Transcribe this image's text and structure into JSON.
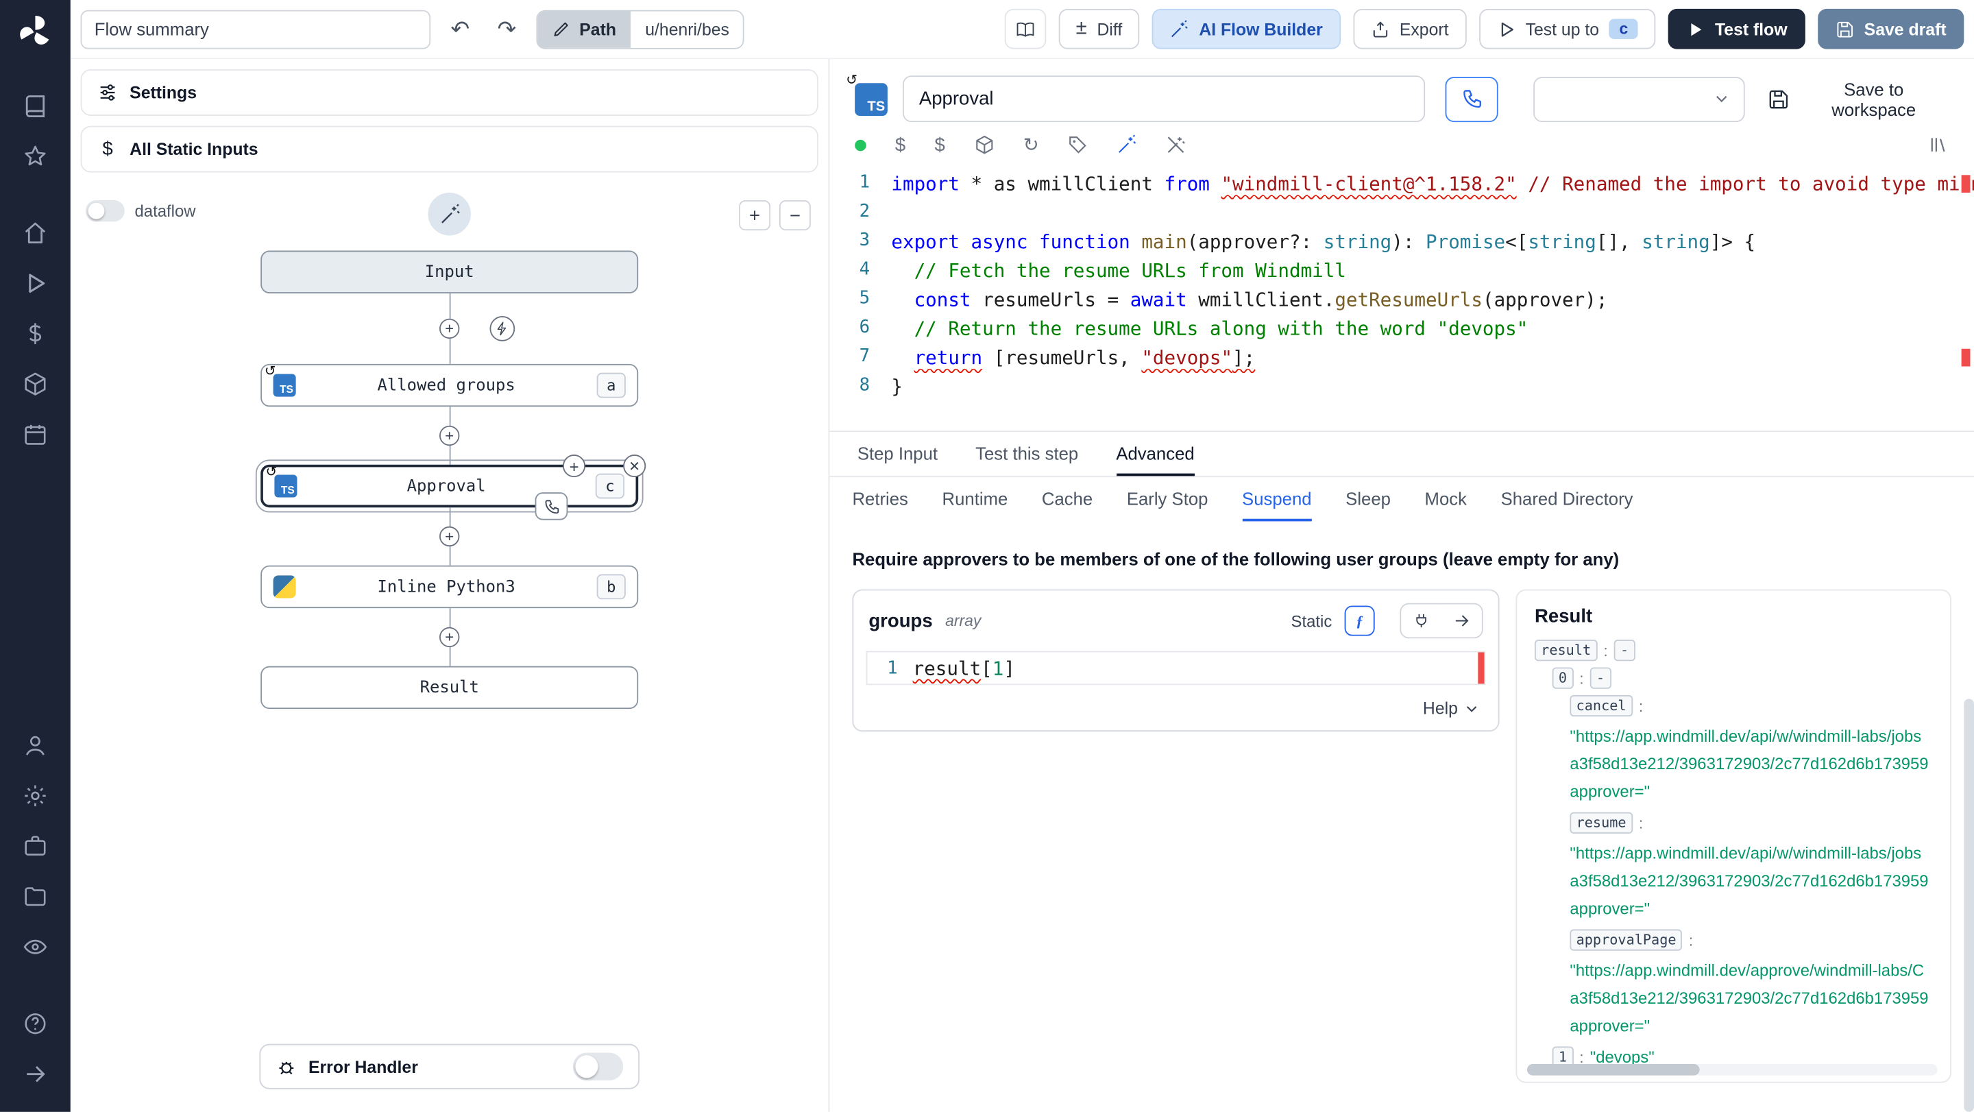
{
  "icons": {
    "undo": "↶",
    "redo": "↷",
    "diff": "±",
    "refresh": "↻",
    "loop": "↺",
    "plus": "+",
    "minus": "−",
    "close": "✕",
    "ts": "TS",
    "dollar": "$",
    "fx": "ƒ"
  },
  "topbar": {
    "flow_summary_value": "Flow summary",
    "path_label": "Path",
    "path_value": "u/henri/bes",
    "diff_label": "Diff",
    "ai_flow_builder_label": "AI Flow Builder",
    "export_label": "Export",
    "test_up_to_label": "Test up to",
    "test_up_to_badge": "c",
    "test_flow_label": "Test flow",
    "save_draft_label": "Save draft"
  },
  "flow_panel": {
    "settings_label": "Settings",
    "static_inputs_label": "All Static Inputs",
    "dataflow_label": "dataflow",
    "nodes": {
      "input_label": "Input",
      "allowed_groups_label": "Allowed groups",
      "allowed_groups_badge": "a",
      "approval_label": "Approval",
      "approval_badge": "c",
      "python_label": "Inline Python3",
      "python_badge": "b",
      "result_label": "Result"
    },
    "error_handler_label": "Error Handler"
  },
  "step": {
    "name_value": "Approval",
    "save_to_workspace_label": "Save to workspace",
    "tabs": [
      "Step Input",
      "Test this step",
      "Advanced"
    ],
    "active_tab": "Advanced",
    "subtabs": [
      "Retries",
      "Runtime",
      "Cache",
      "Early Stop",
      "Suspend",
      "Sleep",
      "Mock",
      "Shared Directory"
    ],
    "active_subtab": "Suspend",
    "code_lines": [
      {
        "n": "1",
        "segs": [
          {
            "c": "kw",
            "t": "import"
          },
          {
            "c": "pln",
            "t": " * as wmillClient "
          },
          {
            "c": "kw",
            "t": "from"
          },
          {
            "c": "pln",
            "t": " "
          },
          {
            "c": "str err",
            "t": "\"windmill-client@^1.158.2\""
          },
          {
            "c": "strc",
            "t": " // Renamed the import to avoid type mismatch"
          }
        ]
      },
      {
        "n": "2",
        "segs": []
      },
      {
        "n": "3",
        "segs": [
          {
            "c": "kw",
            "t": "export"
          },
          {
            "c": "pln",
            "t": " "
          },
          {
            "c": "kw",
            "t": "async"
          },
          {
            "c": "pln",
            "t": " "
          },
          {
            "c": "kw",
            "t": "function"
          },
          {
            "c": "pln",
            "t": " "
          },
          {
            "c": "fn",
            "t": "main"
          },
          {
            "c": "pln",
            "t": "(approver?: "
          },
          {
            "c": "typ",
            "t": "string"
          },
          {
            "c": "pln",
            "t": "): "
          },
          {
            "c": "typ",
            "t": "Promise"
          },
          {
            "c": "pln",
            "t": "<["
          },
          {
            "c": "typ",
            "t": "string"
          },
          {
            "c": "pln",
            "t": "[], "
          },
          {
            "c": "typ",
            "t": "string"
          },
          {
            "c": "pln",
            "t": "]> {"
          }
        ]
      },
      {
        "n": "4",
        "segs": [
          {
            "c": "com",
            "t": "  // Fetch the resume URLs from Windmill"
          }
        ]
      },
      {
        "n": "5",
        "segs": [
          {
            "c": "pln",
            "t": "  "
          },
          {
            "c": "kw",
            "t": "const"
          },
          {
            "c": "pln",
            "t": " resumeUrls = "
          },
          {
            "c": "kw",
            "t": "await"
          },
          {
            "c": "pln",
            "t": " wmillClient."
          },
          {
            "c": "fn",
            "t": "getResumeUrls"
          },
          {
            "c": "pln",
            "t": "(approver);"
          }
        ]
      },
      {
        "n": "6",
        "segs": [
          {
            "c": "com",
            "t": "  // Return the resume URLs along with the word \"devops\""
          }
        ]
      },
      {
        "n": "7",
        "segs": [
          {
            "c": "pln",
            "t": "  "
          },
          {
            "c": "kw err",
            "t": "return"
          },
          {
            "c": "pln",
            "t": " [resumeUrls, "
          },
          {
            "c": "str err",
            "t": "\"devops\""
          },
          {
            "c": "pln err",
            "t": "];"
          }
        ]
      },
      {
        "n": "8",
        "segs": [
          {
            "c": "pln",
            "t": "}"
          }
        ]
      }
    ]
  },
  "suspend": {
    "description": "Require approvers to be members of one of the following user groups (leave empty for any)",
    "field_name": "groups",
    "field_type": "array",
    "static_label": "Static",
    "help_label": "Help",
    "expr_line_no": "1",
    "expr_segs": [
      {
        "c": "pln err",
        "t": "result"
      },
      {
        "c": "pln",
        "t": "["
      },
      {
        "c": "num",
        "t": "1"
      },
      {
        "c": "pln",
        "t": "]"
      }
    ]
  },
  "result_panel": {
    "title": "Result",
    "entries": [
      {
        "indent": 0,
        "key": "result",
        "kind": "dash",
        "value": "-"
      },
      {
        "indent": 1,
        "key": "0",
        "kind": "dash",
        "value": "-"
      },
      {
        "indent": 2,
        "key": "cancel",
        "kind": "url",
        "lines": [
          "\"https://app.windmill.dev/api/w/windmill-labs/jobs",
          "a3f58d13e212/3963172903/2c77d162d6b173959",
          "approver=\""
        ]
      },
      {
        "indent": 2,
        "key": "resume",
        "kind": "url",
        "lines": [
          "\"https://app.windmill.dev/api/w/windmill-labs/jobs",
          "a3f58d13e212/3963172903/2c77d162d6b173959",
          "approver=\""
        ]
      },
      {
        "indent": 2,
        "key": "approvalPage",
        "kind": "url",
        "lines": [
          "\"https://app.windmill.dev/approve/windmill-labs/C",
          "a3f58d13e212/3963172903/2c77d162d6b173959",
          "approver=\""
        ]
      },
      {
        "indent": 1,
        "key": "1",
        "kind": "string",
        "value": "\"devops\""
      }
    ]
  }
}
